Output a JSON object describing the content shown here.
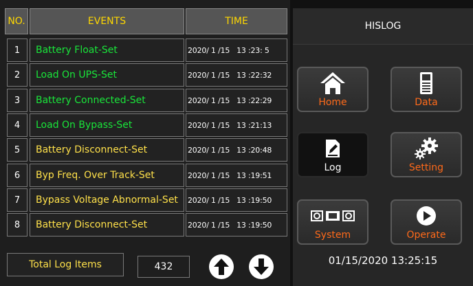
{
  "table": {
    "headers": {
      "no": "NO.",
      "events": "EVENTS",
      "time": "TIME"
    },
    "rows": [
      {
        "no": "1",
        "event": "Battery Float-Set",
        "time": "2020/ 1 /15   13 :23: 5",
        "color": "green"
      },
      {
        "no": "2",
        "event": "Load On UPS-Set",
        "time": "2020/ 1 /15   13 :22:32",
        "color": "green"
      },
      {
        "no": "3",
        "event": "Battery Connected-Set",
        "time": "2020/ 1 /15   13 :22:29",
        "color": "green"
      },
      {
        "no": "4",
        "event": "Load On Bypass-Set",
        "time": "2020/ 1 /15   13 :21:13",
        "color": "green"
      },
      {
        "no": "5",
        "event": "Battery Disconnect-Set",
        "time": "2020/ 1 /15   13 :20:48",
        "color": "yellow"
      },
      {
        "no": "6",
        "event": "Byp Freq. Over Track-Set",
        "time": "2020/ 1 /15   13 :19:51",
        "color": "yellow"
      },
      {
        "no": "7",
        "event": "Bypass Voltage Abnormal-Set",
        "time": "2020/ 1 /15   13 :19:50",
        "color": "yellow"
      },
      {
        "no": "8",
        "event": "Battery Disconnect-Set",
        "time": "2020/ 1 /15   13 :19:50",
        "color": "yellow"
      }
    ]
  },
  "footer": {
    "total_label": "Total Log Items",
    "total_value": "432",
    "up_icon": "arrow-up-circle-icon",
    "down_icon": "arrow-down-circle-icon"
  },
  "menu": {
    "title": "HISLOG",
    "buttons": {
      "home": {
        "label": "Home",
        "icon": "home-icon"
      },
      "data": {
        "label": "Data",
        "icon": "data-meter-icon"
      },
      "log": {
        "label": "Log",
        "icon": "log-edit-icon"
      },
      "setting": {
        "label": "Setting",
        "icon": "gears-icon"
      },
      "system": {
        "label": "System",
        "icon": "system-modules-icon"
      },
      "operate": {
        "label": "Operate",
        "icon": "play-icon"
      }
    },
    "datetime": "01/15/2020  13:25:15"
  },
  "colors": {
    "header_text": "#ffd800",
    "event_green": "#19e63a",
    "event_yellow": "#ffe14a",
    "menu_label": "#ff6a1a"
  }
}
